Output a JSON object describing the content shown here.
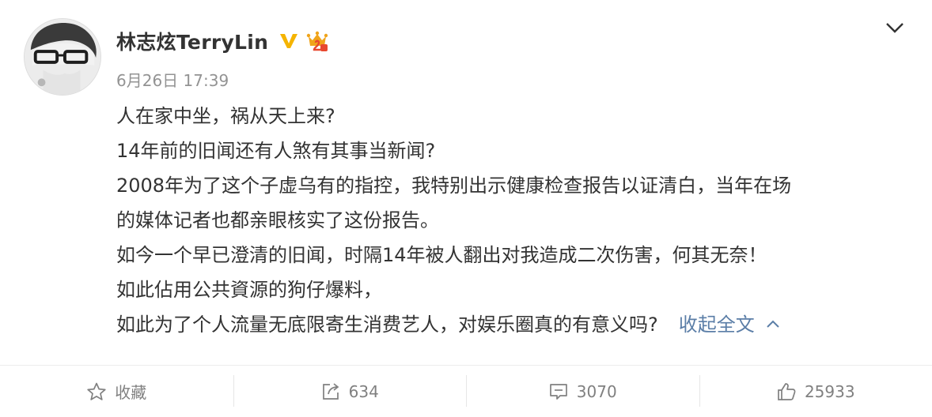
{
  "author": {
    "name": "林志炫TerryLin",
    "verified_icon": "verified-v-badge-icon",
    "vip_icon": "vip-member-badge-icon",
    "avatar": "user-avatar",
    "accent_color": "#f5b400"
  },
  "post": {
    "timestamp": "6月26日 17:39",
    "lines": [
      "人在家中坐，祸从天上来?",
      "14年前的旧闻还有人煞有其事当新闻?",
      "2008年为了这个子虚乌有的指控，我特别出示健康检查报告以证清白，当年在场",
      "的媒体记者也都亲眼核实了这份报告。",
      "如今一个早已澄清的旧闻，时隔14年被人翻出对我造成二次伤害，何其无奈！",
      "如此佔用公共資源的狗仔爆料，",
      "如此为了个人流量无底限寄生消费艺人，对娱乐圈真的有意义吗?"
    ],
    "collapse_label": "收起全文",
    "link_color": "#5b7ea7"
  },
  "menu": {
    "icon": "chevron-down-icon"
  },
  "actions": {
    "favorite": {
      "label": "收藏",
      "icon": "star-icon"
    },
    "repost": {
      "count": "634",
      "icon": "share-icon"
    },
    "comment": {
      "count": "3070",
      "icon": "comment-icon"
    },
    "like": {
      "count": "25933",
      "icon": "thumbs-up-icon"
    }
  }
}
